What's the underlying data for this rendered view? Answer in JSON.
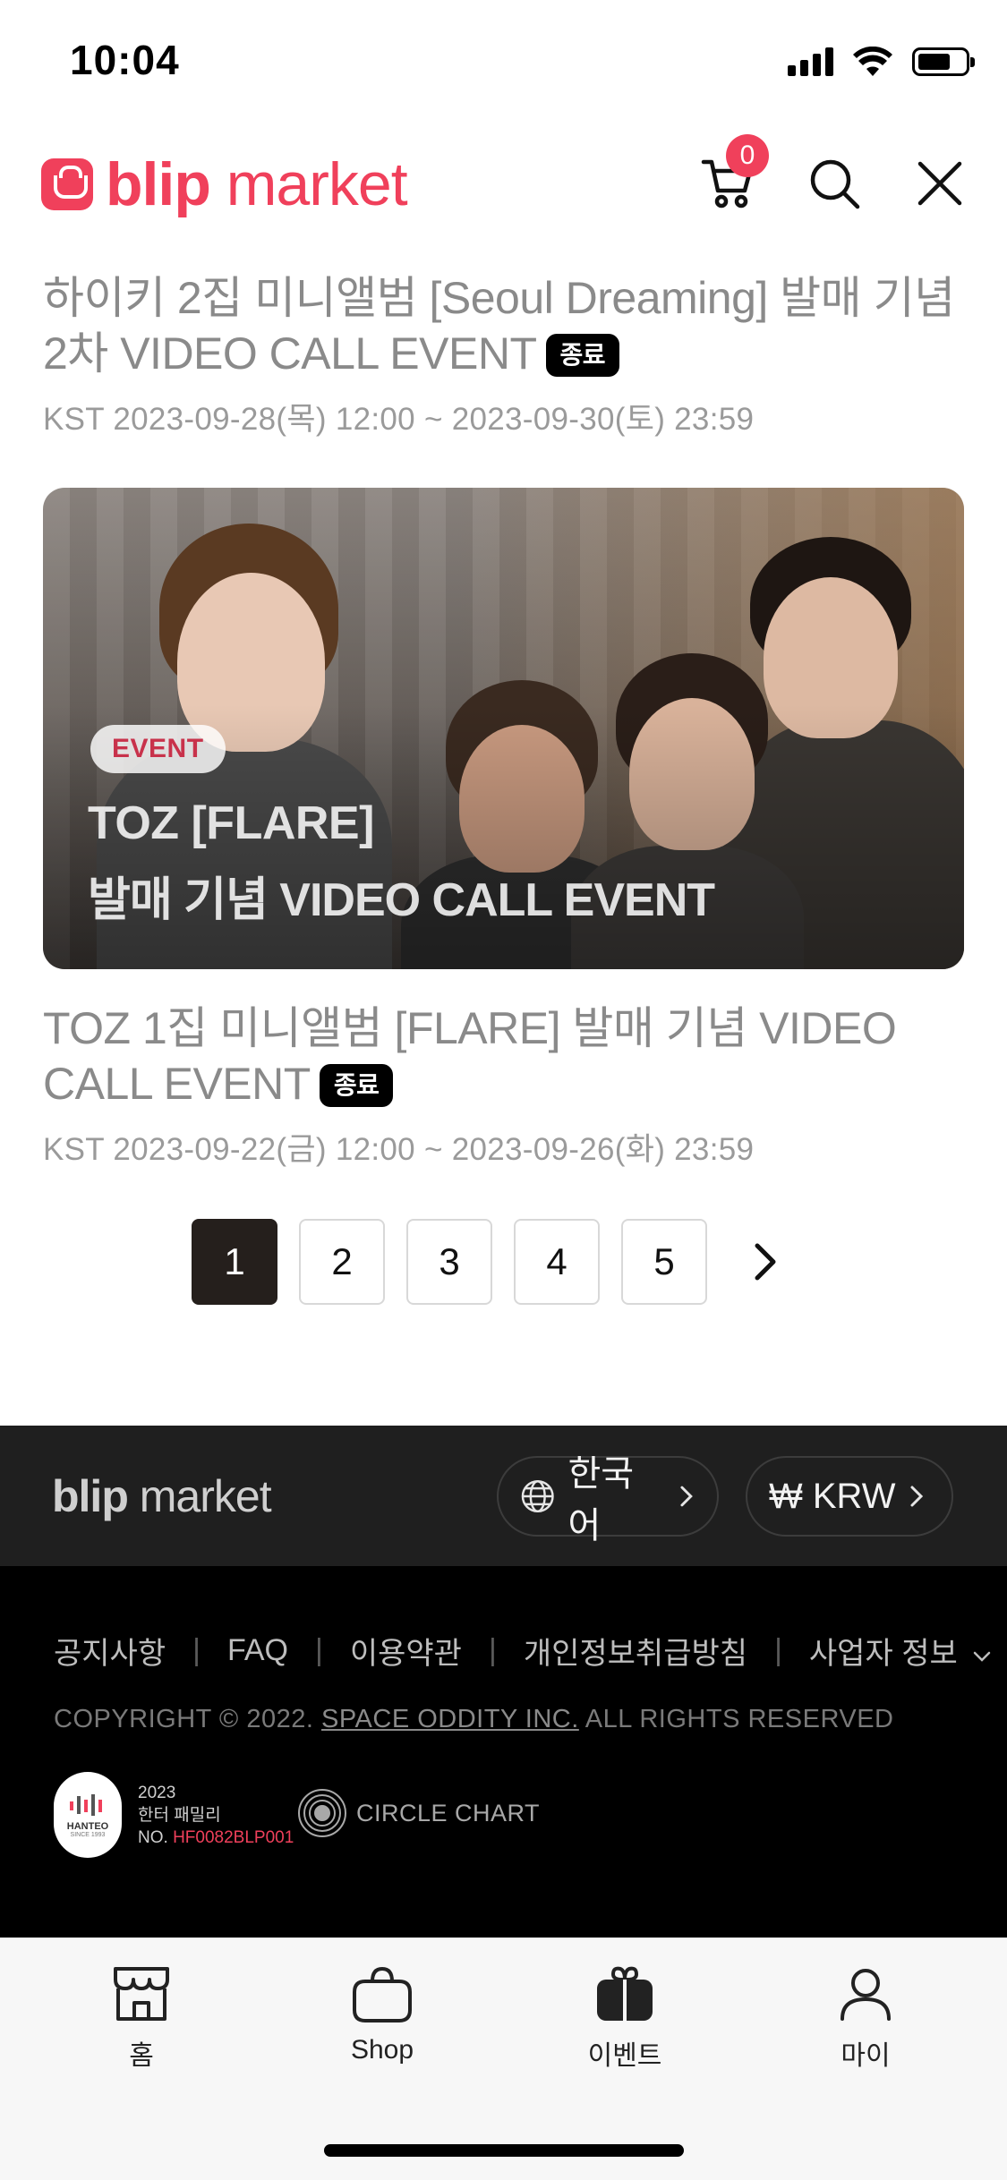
{
  "status_bar": {
    "time": "10:04"
  },
  "header": {
    "logo_bold": "blip",
    "logo_light": "market",
    "cart_count": "0"
  },
  "events": [
    {
      "title": "하이키 2집 미니앨범 [Seoul Dreaming] 발매 기념 2차 VIDEO CALL EVENT",
      "badge": "종료",
      "period": "KST 2023-09-28(목) 12:00 ~ 2023-09-30(토) 23:59"
    },
    {
      "banner_tag": "EVENT",
      "banner_line1": "TOZ [FLARE]",
      "banner_line2": "발매 기념 VIDEO CALL EVENT",
      "title": "TOZ 1집 미니앨범 [FLARE] 발매 기념 VIDEO CALL EVENT",
      "badge": "종료",
      "period": "KST 2023-09-22(금) 12:00 ~ 2023-09-26(화) 23:59"
    }
  ],
  "pagination": {
    "pages": [
      "1",
      "2",
      "3",
      "4",
      "5"
    ],
    "current": "1"
  },
  "footer": {
    "logo_bold": "blip",
    "logo_light": "market",
    "language": "한국어",
    "currency": "₩ KRW",
    "links": [
      "공지사항",
      "FAQ",
      "이용약관",
      "개인정보취급방침",
      "사업자 정보"
    ],
    "copyright_prefix": "COPYRIGHT © 2022.",
    "copyright_company": "SPACE ODDITY INC.",
    "copyright_suffix": "ALL RIGHTS RESERVED",
    "hanteo": {
      "seal_text": "HANTEO",
      "seal_since": "SINCE 1993",
      "year": "2023",
      "label": "한터 패밀리",
      "no_prefix": "NO.",
      "no_value": "HF0082BLP001"
    },
    "circle_chart": "CIRCLE CHART"
  },
  "tab_bar": {
    "tabs": [
      {
        "label": "홈",
        "icon": "store-icon"
      },
      {
        "label": "Shop",
        "icon": "bag-icon"
      },
      {
        "label": "이벤트",
        "icon": "gift-icon"
      },
      {
        "label": "마이",
        "icon": "person-icon"
      }
    ]
  },
  "colors": {
    "brand": "#f0405b",
    "footer_dark": "#1f1f1f",
    "page_active": "#251f1c"
  }
}
